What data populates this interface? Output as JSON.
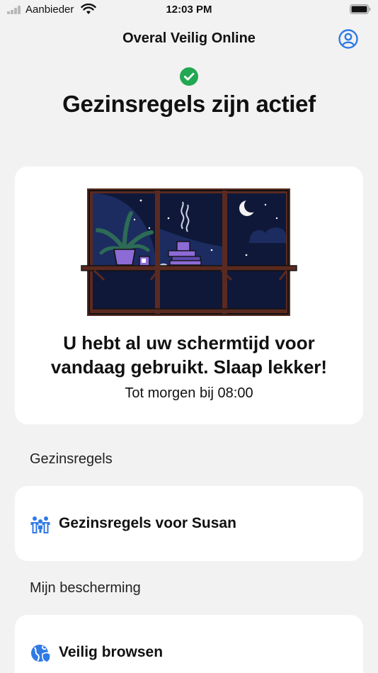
{
  "status_bar": {
    "carrier": "Aanbieder",
    "time": "12:03 PM"
  },
  "header": {
    "title": "Overal Veilig Online",
    "profile_icon": "person-circle-icon"
  },
  "status": {
    "icon": "check-circle-icon",
    "headline": "Gezinsregels zijn actief"
  },
  "hero": {
    "illustration": "night-window-illustration",
    "message_line1": "U hebt al uw schermtijd voor",
    "message_line2": "vandaag gebruikt. Slaap lekker!",
    "subtitle": "Tot morgen bij 08:00"
  },
  "sections": {
    "family_rules_label": "Gezinsregels",
    "family_rules_item": "Gezinsregels voor Susan",
    "family_rules_icon": "family-icon",
    "my_protection_label": "Mijn bescherming",
    "safe_browsing_item": "Veilig browsen",
    "safe_browsing_icon": "globe-shield-icon"
  },
  "colors": {
    "accent": "#2f7ae5",
    "success": "#22a852",
    "night_sky": "#0f1838",
    "frame": "#5a2a20",
    "purple": "#8c6bd6",
    "background": "#f2f2f2"
  }
}
